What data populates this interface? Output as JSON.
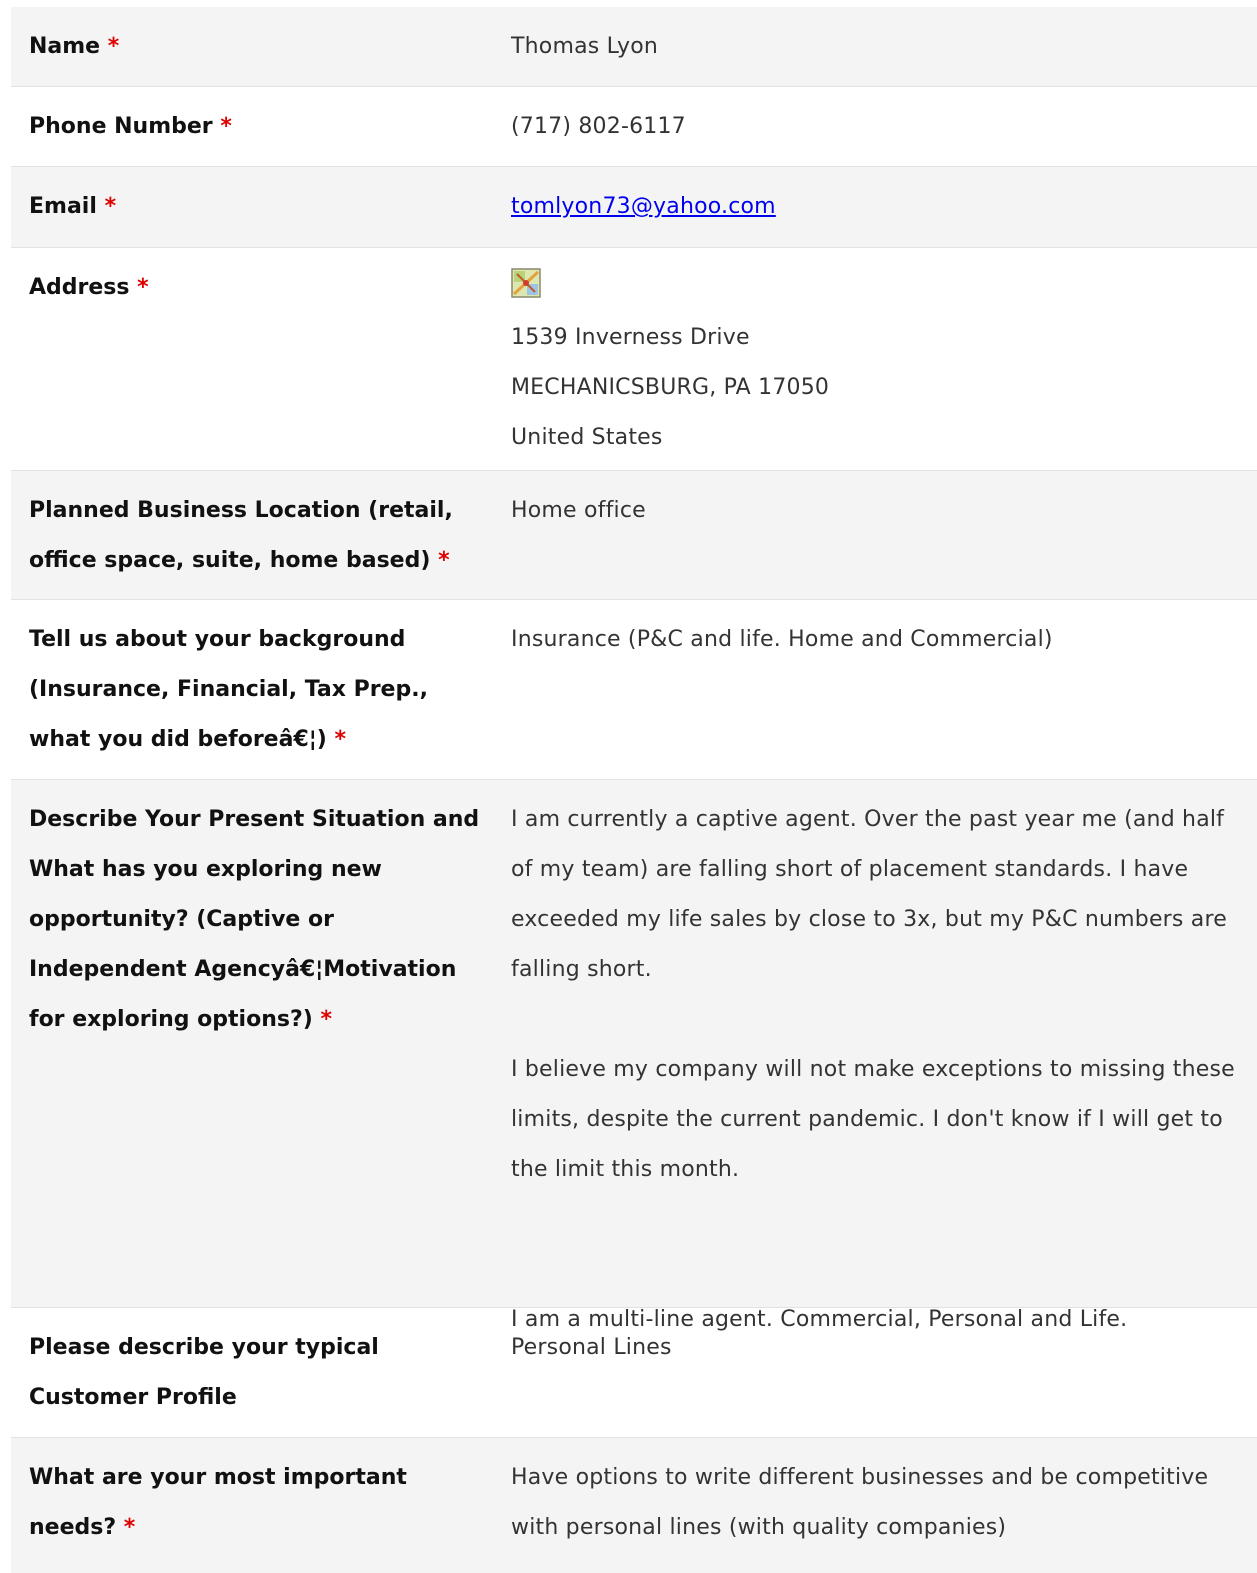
{
  "fields": {
    "name": {
      "label": "Name",
      "required": "*",
      "value": "Thomas Lyon"
    },
    "phone": {
      "label": "Phone Number",
      "required": "*",
      "value": "(717) 802-6117"
    },
    "email": {
      "label": "Email",
      "required": "*",
      "value": "tomlyon73@yahoo.com"
    },
    "address": {
      "label": "Address",
      "required": "*",
      "icon": "map-icon",
      "line1": "1539 Inverness Drive",
      "line2": "MECHANICSBURG, PA 17050",
      "line3": "United States"
    },
    "location": {
      "label": "Planned Business Location (retail, office space, suite, home based)",
      "required": "*",
      "value": "Home office"
    },
    "background": {
      "label": "Tell us about your background (Insurance, Financial, Tax Prep., what you did beforeâ€¦)",
      "required": "*",
      "value": "Insurance (P&C and life. Home and Commercial)"
    },
    "situation": {
      "label": "Describe Your Present Situation and What has you exploring new opportunity? (Captive or Independent Agencyâ€¦Motivation for exploring options?)",
      "required": "*",
      "para1": "I am currently a captive agent. Over the past year me (and half of my team) are falling short of placement standards. I have exceeded my life sales by close to 3x, but my P&C numbers are falling short.",
      "para2": "I believe my company will not make exceptions to missing these limits, despite the current pandemic. I don't know if I will get to the limit this month.",
      "para3": "I am a multi-line agent. Commercial, Personal and Life."
    },
    "customer_profile": {
      "label": "Please describe your typical Customer Profile",
      "value": "Personal Lines"
    },
    "needs": {
      "label": "What are your most important needs?",
      "required": "*",
      "value": "Have options to write different businesses and be competitive with personal lines (with quality companies)"
    }
  }
}
